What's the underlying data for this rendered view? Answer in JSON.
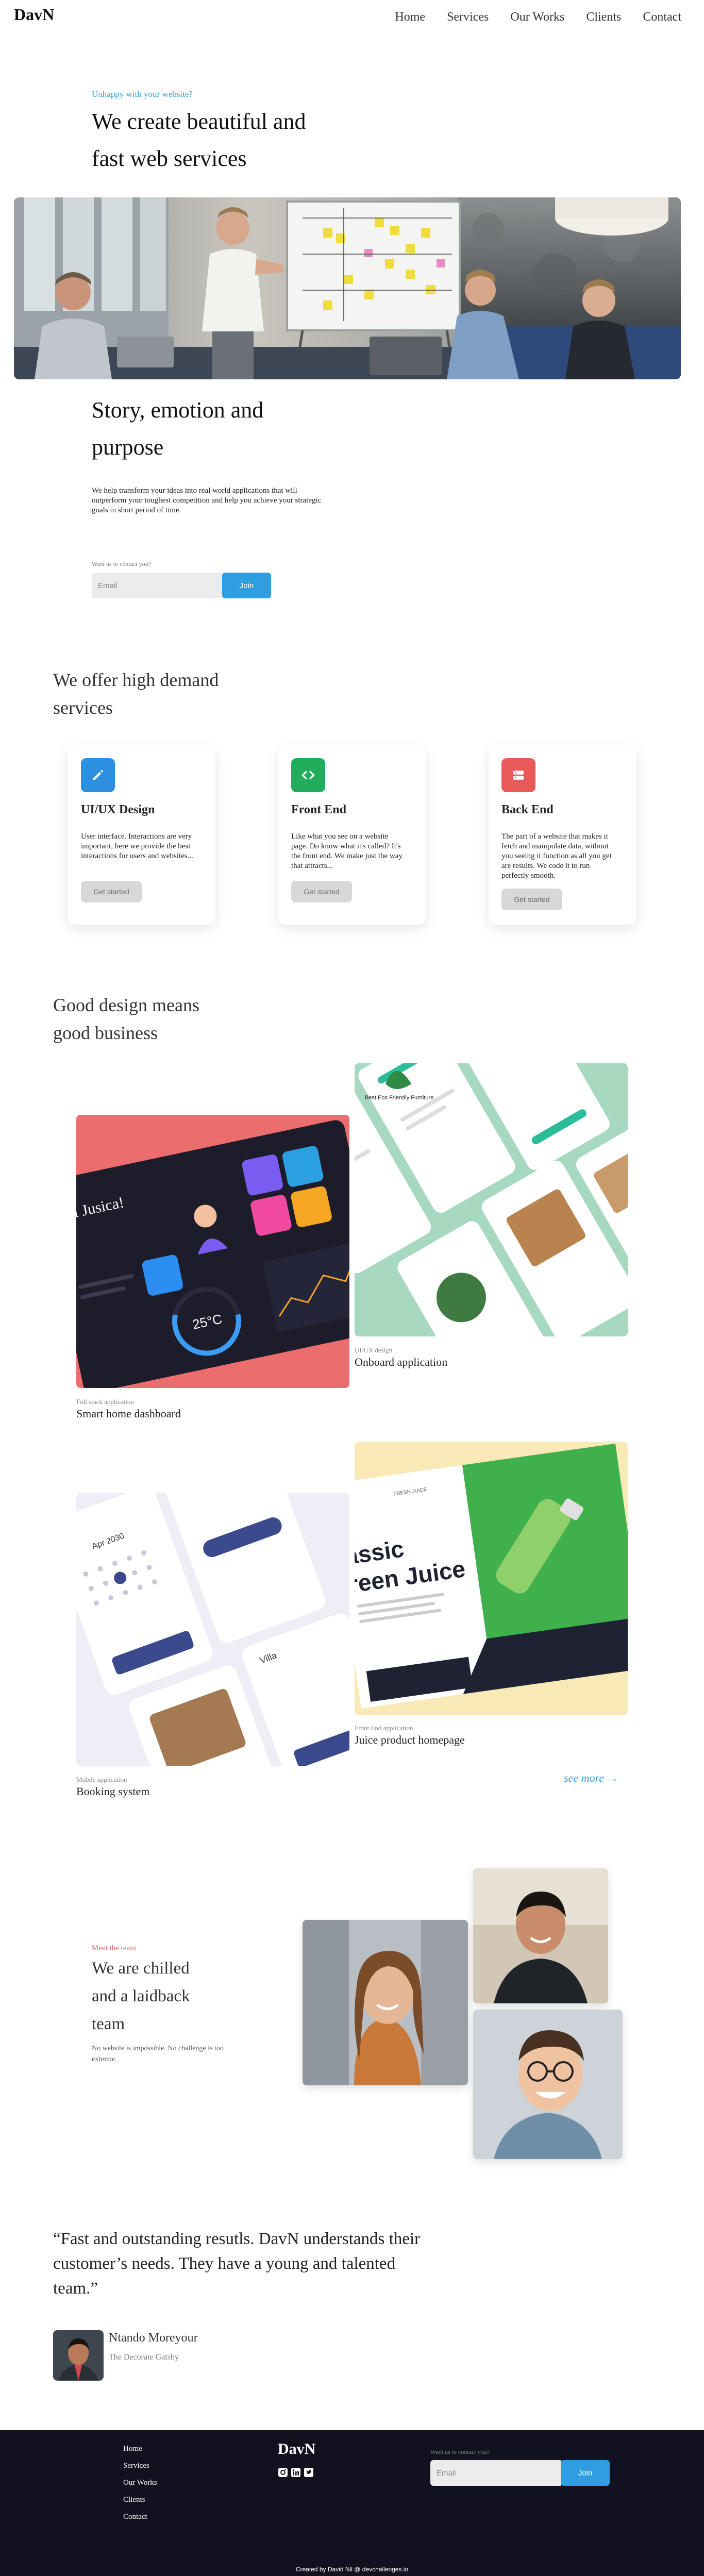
{
  "nav": {
    "logo": "DavN",
    "links": [
      "Home",
      "Services",
      "Our Works",
      "Clients",
      "Contact"
    ]
  },
  "hero": {
    "eyebrow": "Unhappy with your website?",
    "title": "We create beautiful and fast web services",
    "story_title": "Story, emotion and purpose",
    "story_text": "We help transform your ideas into real world applications that will outperform your toughest competition and help you achieve your strategic goals in short period of time.",
    "contact_label": "Want us to contact you?",
    "email_placeholder": "Email",
    "join_label": "Join"
  },
  "services": {
    "title": "We offer high demand services",
    "cards": [
      {
        "title": "UI/UX Design",
        "text": "User interface. Interactions are very important, here we provide the best interactions for users and websites...",
        "button": "Get started",
        "color": "#2d8fe0",
        "icon": "pencil-icon"
      },
      {
        "title": "Front End",
        "text": "Like what you see on a website page. Do know what it's called? It's the front end. We make just the way that attracts...",
        "button": "Get started",
        "color": "#22ad5c",
        "icon": "code-icon"
      },
      {
        "title": "Back End",
        "text": "The part of a website that makes it fetch and manipulate data, without you seeing it function as all you get are results. We code it to run perfectly smooth.",
        "button": "Get started",
        "color": "#e85a5a",
        "icon": "server-icon"
      }
    ]
  },
  "works": {
    "title": "Good design means good business",
    "items": [
      {
        "category": "Full stack application",
        "name": "Smart home dashboard"
      },
      {
        "category": "UI/UX design",
        "name": "Onboard application"
      },
      {
        "category": "Mobile application",
        "name": "Booking system"
      },
      {
        "category": "Front End application",
        "name": "Juice product homepage"
      }
    ],
    "see_more": "see more →",
    "mockups": {
      "dashboard_greeting": "Hi Jusica!",
      "dashboard_temp": "25°C",
      "juice_title_1": "assic",
      "juice_title_2": "reen Juice",
      "juice_brand": "FRESH JUICE",
      "booking_title_1": "Apr 2030",
      "booking_title_2": "Villa",
      "onboard_title": "Best Eco Friendly Furniture"
    }
  },
  "team": {
    "eyebrow": "Meet the team",
    "title": "We are chilled and a laidback team",
    "text": "No website is impossible. No challenge is too extreme."
  },
  "testimonial": {
    "quote": "“Fast and outstanding resutls. DavN understands their customer’s needs. They have a young and talented team.”",
    "name": "Ntando Moreyour",
    "company": "The Decorate Gatsby"
  },
  "footer": {
    "links": [
      "Home",
      "Services",
      "Our Works",
      "Clients",
      "Contact"
    ],
    "logo": "DavN",
    "contact_label": "Want us to contact you?",
    "email_placeholder": "Email",
    "join_label": "Join",
    "credit": "Created by David Nil @ devchallenges.io"
  },
  "colors": {
    "accent_blue": "#2f9ee0",
    "accent_red": "#e85a5a",
    "footer_bg": "#12111f"
  }
}
